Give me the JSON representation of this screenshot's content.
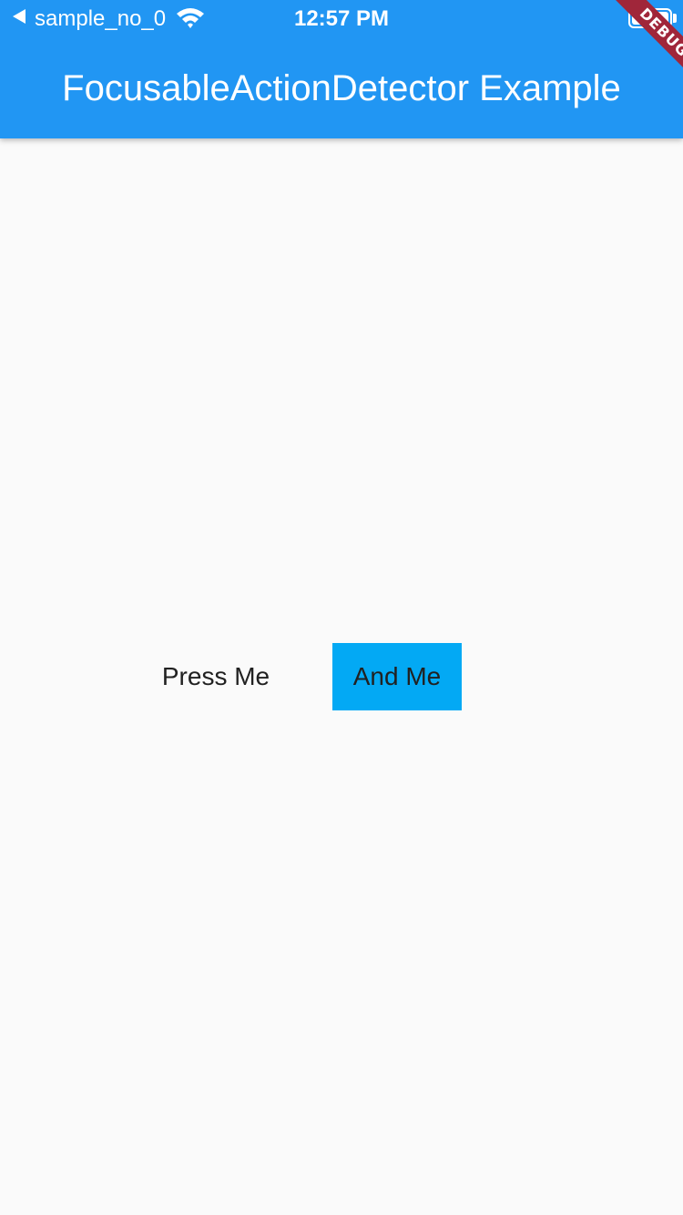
{
  "status_bar": {
    "carrier": "sample_no_0",
    "time": "12:57 PM",
    "back_icon": "back-arrow-icon",
    "wifi_icon": "wifi-icon",
    "battery_icon": "battery-icon"
  },
  "app_bar": {
    "title": "FocusableActionDetector Example",
    "color": "#2196f3"
  },
  "debug_banner": {
    "label": "DEBUG",
    "color": "#a0263a"
  },
  "buttons": {
    "press_me": "Press Me",
    "and_me": "And Me",
    "and_me_color": "#03a9f4"
  }
}
